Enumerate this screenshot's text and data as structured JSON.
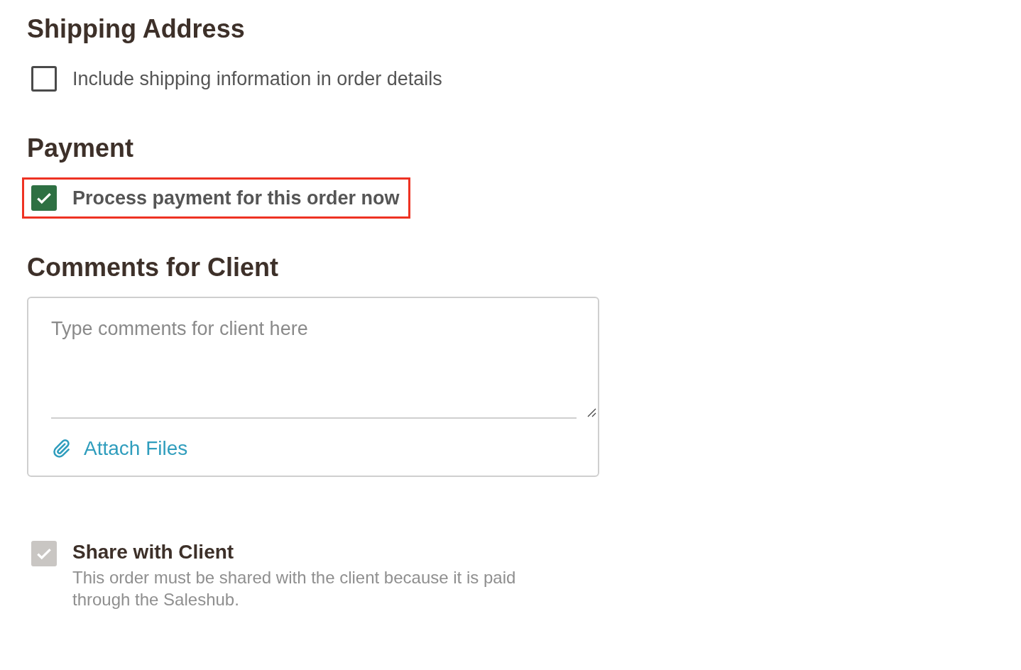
{
  "shipping": {
    "title": "Shipping Address",
    "option": {
      "label": "Include shipping information in order details",
      "checked": false,
      "highlighted": false,
      "bold": false
    }
  },
  "payment": {
    "title": "Payment",
    "option": {
      "label": "Process payment for this order now",
      "checked": true,
      "highlighted": true,
      "bold": true
    }
  },
  "comments": {
    "title": "Comments for Client",
    "placeholder": "Type comments for client here",
    "attach_label": "Attach Files"
  },
  "share": {
    "label": "Share with Client",
    "checked": true,
    "disabled": true,
    "note": "This order must be shared with the client because it is paid through the Saleshub."
  }
}
